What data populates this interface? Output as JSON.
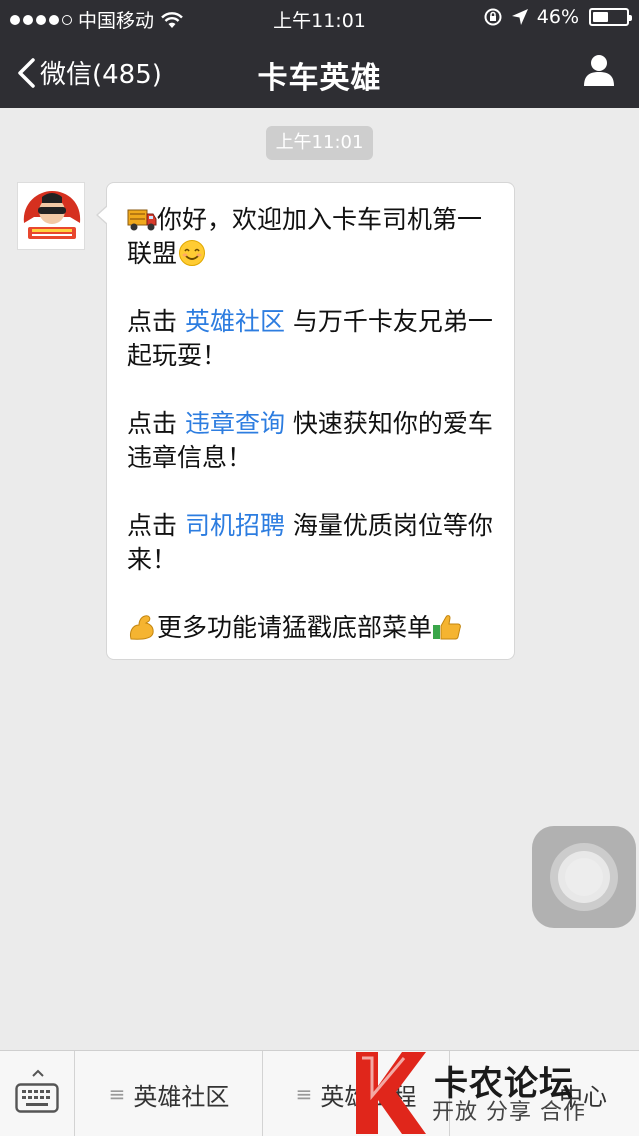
{
  "status_bar": {
    "carrier": "中国移动",
    "time": "上午11:01",
    "battery_percent": "46%",
    "battery_level": 0.46,
    "icons": [
      "signal-dots-icon",
      "wifi-icon",
      "rotation-lock-icon",
      "location-arrow-icon",
      "battery-icon"
    ]
  },
  "nav": {
    "back_label": "微信(485)",
    "title": "卡车英雄",
    "profile_icon": "person-icon"
  },
  "chat": {
    "timestamp": "上午11:01",
    "message": {
      "intro_text": "你好，欢迎加入卡车司机第一联盟",
      "line1_prefix": "点击 ",
      "line1_link": "英雄社区",
      "line1_suffix": " 与万千卡友兄弟一起玩耍！",
      "line2_prefix": "点击 ",
      "line2_link": "违章查询",
      "line2_suffix": " 快速获知你的爱车违章信息！",
      "line3_prefix": "点击 ",
      "line3_link": "司机招聘",
      "line3_suffix": " 海量优质岗位等你来！",
      "outro_text": "更多功能请猛戳底部菜单",
      "emojis": [
        "truck-emoji",
        "smile-emoji",
        "flexed-biceps-emoji",
        "thumbs-up-emoji"
      ]
    },
    "link_color": "#2d7de0"
  },
  "bottom_menu": {
    "keyboard_icon": "keyboard-icon",
    "items": [
      {
        "label": "英雄社区"
      },
      {
        "label": "英雄工程"
      },
      {
        "label": "中心"
      }
    ]
  },
  "watermark": {
    "title": "卡农论坛",
    "subtitle": "开放 分享 合作"
  }
}
